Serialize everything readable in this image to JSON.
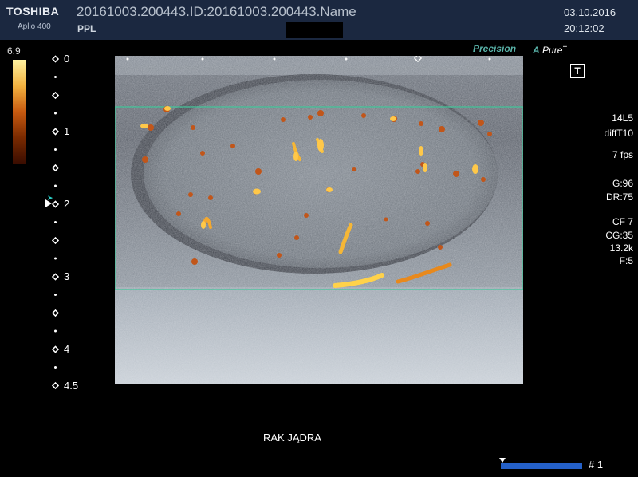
{
  "header": {
    "brand": "TOSHIBA",
    "model": "Aplio 400",
    "patient_id": "20161003.200443.ID:20161003.200443.Name",
    "preset": "PPL",
    "date": "03.10.2016",
    "time": "20:12:02"
  },
  "color_bar": {
    "max_label": "6.9"
  },
  "depth_scale": {
    "labels": [
      "0",
      "1",
      "2",
      "3",
      "4",
      "4.5"
    ]
  },
  "top_right": {
    "precision": "Precision",
    "apure_a": "A",
    "apure_rest": "Pure",
    "apure_plus": "+",
    "t_button": "T"
  },
  "parameters": {
    "probe": "14L5",
    "mode": "diffT10",
    "fps": "7 fps",
    "gain": "G:96",
    "dr": "DR:75",
    "cf": "CF 7",
    "cg": "CG:35",
    "prf": "13.2k",
    "filter": "F:5"
  },
  "caption": "RAK JĄDRA",
  "cine": {
    "label": "# 1"
  },
  "colors": {
    "header_bg": "#1b2840",
    "roi_box": "#3fc79a",
    "accent": "#59b3a9",
    "cine_bar": "#2460c8"
  }
}
